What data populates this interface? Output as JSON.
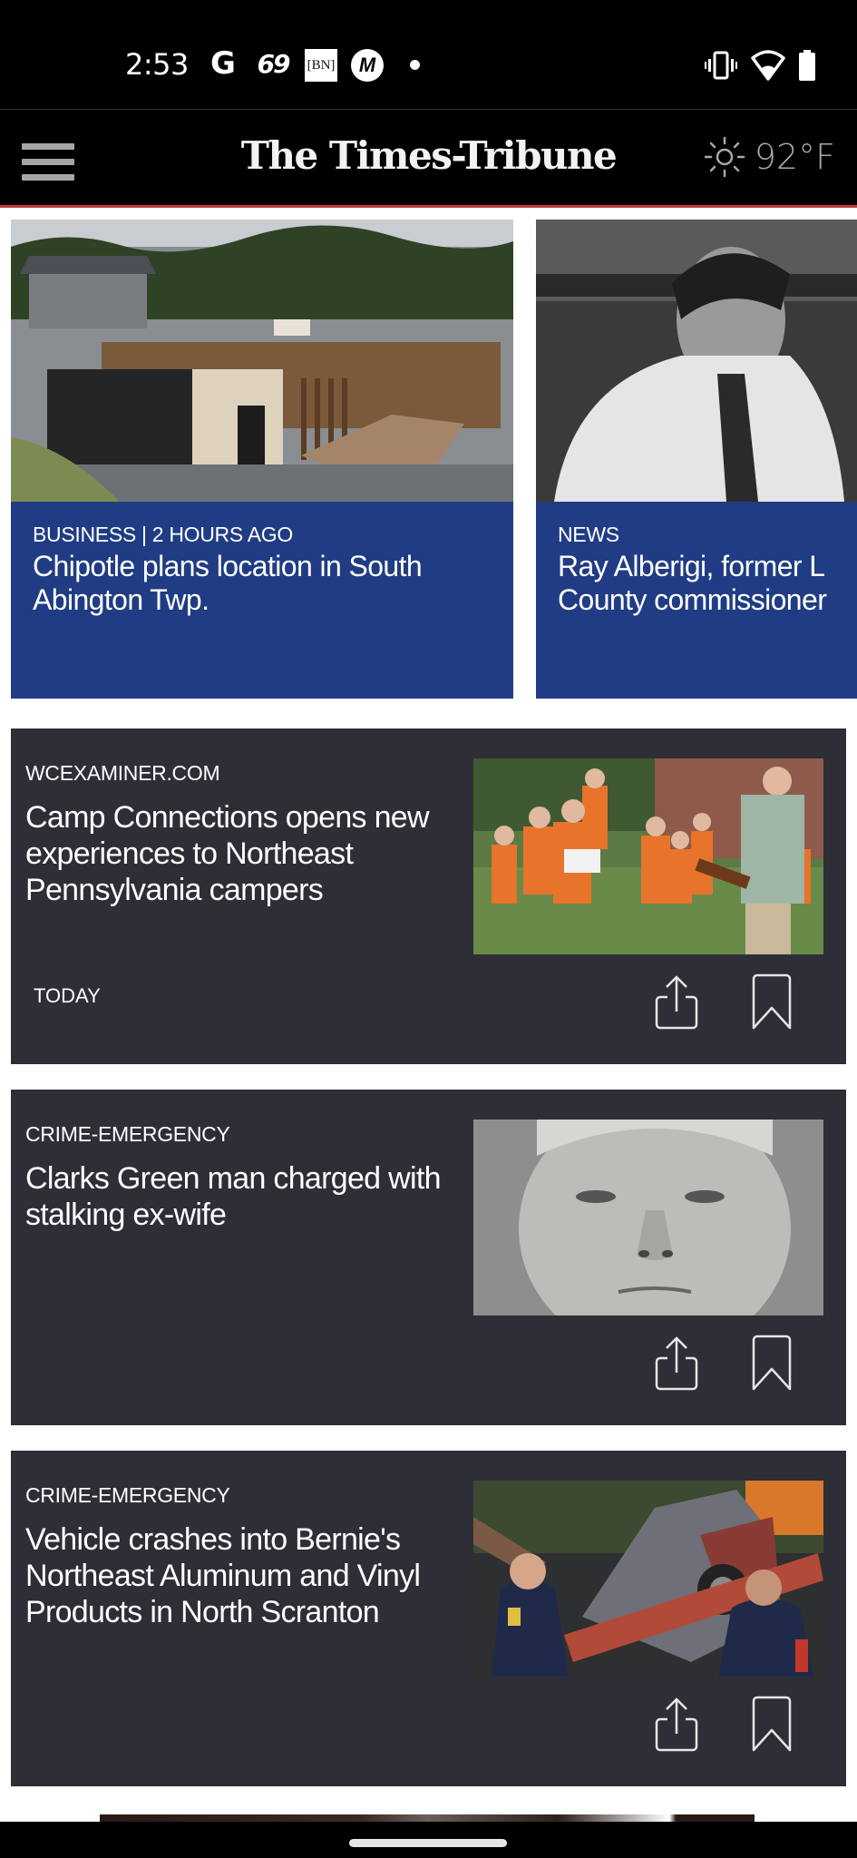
{
  "status_bar": {
    "time": "2:53",
    "left_icons": [
      "google-icon",
      "app-69-icon",
      "bn-news-icon",
      "m-app-icon",
      "notification-dot-icon"
    ],
    "bn_label": "[BN]",
    "g_label": "G",
    "sixty_nine_label": "69",
    "m_label": "M",
    "right_icons": [
      "vibrate-icon",
      "wifi-icon",
      "battery-icon"
    ]
  },
  "header": {
    "title": "The Times-Tribune",
    "menu_icon": "hamburger-menu-icon",
    "weather_icon": "sun-icon",
    "temperature": "92°F",
    "accent_color": "#c0393b"
  },
  "carousel": {
    "background_color": "#203c84",
    "items": [
      {
        "meta": "BUSINESS | 2 HOURS AGO",
        "title_line1": "Chipotle plans location in South",
        "title_line2": "Abington Twp.",
        "image": "burned-building-photo"
      },
      {
        "meta": "NEWS",
        "title_line1": "Ray Alberigi, former L",
        "title_line2": "County commissioner",
        "image": "man-portrait-photo"
      }
    ]
  },
  "feed": {
    "card_color": "#2e2e37",
    "items": [
      {
        "source": "WCEXAMINER.COM",
        "title": "Camp Connections opens new experiences to Northeast Pennsylvania campers",
        "date": "TODAY",
        "image": "campers-singing-photo"
      },
      {
        "source": "CRIME-EMERGENCY",
        "title": "Clarks Green man charged with stalking ex-wife",
        "date": "",
        "image": "mugshot-photo"
      },
      {
        "source": "CRIME-EMERGENCY",
        "title": "Vehicle crashes into Bernie's Northeast Aluminum and Vinyl Products in North Scranton",
        "date": "",
        "image": "vehicle-crash-photo"
      }
    ]
  }
}
